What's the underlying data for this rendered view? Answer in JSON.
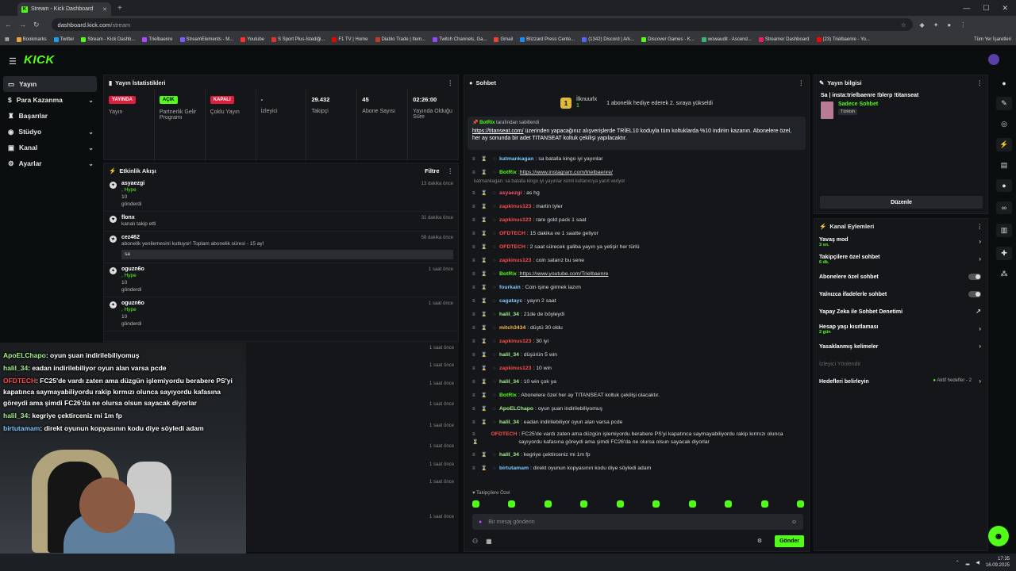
{
  "browser": {
    "tab_title": "Stream - Kick Dashboard",
    "url_host": "dashboard.kick.com",
    "url_path": "/stream",
    "bookmarks": [
      "Bookmarks",
      "Twitter",
      "Stream - Kick Dashb...",
      "Trielbaenre",
      "StreamElements - M...",
      "Youtube",
      "S Sport Plus-İstediği...",
      "F1 TV | Home",
      "Diablo Trade | Item...",
      "Twitch Channels, Ga...",
      "Gmail",
      "Blizzard Press Cente...",
      "(1342) Discord | Ark...",
      "Discover Games - K...",
      "wowaudit - Ascend...",
      "Streamer Dashboard",
      "(23) Trielbaenre - Yo..."
    ],
    "bookmarks_all": "Tüm Yer İşaretleri"
  },
  "brand": {
    "logo": "KICK",
    "accent": "#53fc18"
  },
  "sidebar": {
    "items": [
      {
        "label": "Yayın"
      },
      {
        "label": "Para Kazanma"
      },
      {
        "label": "Başarılar"
      },
      {
        "label": "Stüdyo"
      },
      {
        "label": "Kanal"
      },
      {
        "label": "Ayarlar"
      }
    ]
  },
  "stats": {
    "title": "Yayın İstatistikleri",
    "items": [
      {
        "value": "YAYINDA",
        "label": "Yayın"
      },
      {
        "value": "AÇIK",
        "label": "Partnerlik Gelir Programı"
      },
      {
        "value": "KAPALI",
        "label": "Çoklu Yayın"
      },
      {
        "value": "-",
        "label": "İzleyici"
      },
      {
        "value": "29.432",
        "label": "Takipçi"
      },
      {
        "value": "45",
        "label": "Abone Sayısı"
      },
      {
        "value": "02:26:00",
        "label": "Yayında Olduğu Süre"
      }
    ]
  },
  "feed": {
    "title": "Etkinlik Akışı",
    "filter": "Filtre",
    "events": [
      {
        "user": "asyaezgi",
        "line1": ", Hype",
        "line2": "10",
        "line3": "gönderdi",
        "time": "13 dakika önce"
      },
      {
        "user": "flonx",
        "line1": "kanalı takip etti",
        "time": "31 dakika önce"
      },
      {
        "user": "cez462",
        "line1": "abonelik yenilemesini kutluyor! Toplam abonelik süresi - 15 ay!",
        "note": "sa",
        "time": "58 dakika önce"
      },
      {
        "user": "oguzn6o",
        "line1": ", Hype",
        "line2": "10",
        "line3": "gönderdi",
        "time": "1 saat önce"
      },
      {
        "user": "oguzn6o",
        "line1": ", Hype",
        "line2": "10",
        "line3": "gönderdi",
        "time": "1 saat önce"
      }
    ],
    "lower_times": [
      "1 saat önce",
      "1 saat önce",
      "1 saat önce",
      "1 saat önce",
      "1 saat önce",
      "1 saat önce",
      "1 saat önce",
      "1 saat önce",
      "1 saat önce"
    ],
    "hidden_frag": "kanalı takip etti"
  },
  "cam_chat": [
    {
      "user": "ApoELChapo",
      "text": ": oyun şuan indirilebiliyomuş"
    },
    {
      "user": "halil_34",
      "text": ": eadan indirilebiliyor oyun alan varsa pcde"
    },
    {
      "user": "OFDTECH",
      "text": ": FC25'de vardı zaten ama düzgün işlemiyordu berabere PS'yi kapatınca saymayabiliyordu rakip kırmızı olunca sayıyordu kafasına göreydi ama şimdi FC26'da ne olursa olsun sayacak diyorlar"
    },
    {
      "user": "halil_34",
      "text": ": kegriye çektirceniz mi 1m fp"
    },
    {
      "user": "birtutamam",
      "text": ": direkt oyunun kopyasının kodu diye söyledi adam"
    }
  ],
  "chat": {
    "title": "Sohbet",
    "gift_user": "İlknuurlx",
    "gift_count": "1",
    "gift_text": "1 abonelik hediye ederek 2. sıraya yükseldi",
    "pinned_by_user": "BotRix",
    "pinned_by_suffix": "tarafından sabitlendi",
    "pinned_link": "https://titanseat.com/",
    "pinned_text": "üzerinden yapacağınız alışverişlerde TRİEL10 koduyla tüm koltuklarda %10 indirim kazanın. Abonelere özel, her ay sonunda bir adet TITANSEAT koltuk çekilişi yapılacaktır.",
    "messages": [
      {
        "user": "katmankagan",
        "text": ": sa batalla kingo iyi yayınlar",
        "color": "#7fc8ff"
      },
      {
        "user": "BotRix",
        "text": ": ",
        "link": "https://www.instagram.com/trielbaenre/",
        "color": "#53fc18"
      },
      {
        "reply": "katmankagan: sa batalla kingo iyi yayınlar isimli kullanıcıya yanıt veriyor"
      },
      {
        "user": "asyaezgi",
        "text": ": as hg",
        "color": "#ff4d6d"
      },
      {
        "user": "zapkinus123",
        "text": ": martin tyler",
        "color": "#ff4d4d"
      },
      {
        "user": "zapkinus123",
        "text": ": rare gold pack 1 saat",
        "color": "#ff4d4d"
      },
      {
        "user": "OFDTECH",
        "text": ": 15 dakika ve 1 saatte geliyor",
        "color": "#ff4d4d"
      },
      {
        "user": "OFDTECH",
        "text": ": 2 saat sürecek galiba yayın ya yetişir her türlü",
        "color": "#ff4d4d"
      },
      {
        "user": "zapkinus123",
        "text": ": coin satarız bu sene",
        "color": "#ff4d4d"
      },
      {
        "user": "BotRix",
        "text": ": ",
        "link": "https://www.youtube.com/Trielbaenre",
        "color": "#53fc18"
      },
      {
        "user": "fourkain",
        "text": ": Coin işine girmek lazım",
        "color": "#7fc8ff"
      },
      {
        "user": "cagatayc",
        "text": ": yayın 2 saat",
        "color": "#7fc8ff"
      },
      {
        "user": "halil_34",
        "text": ": 21de de böyleydi",
        "color": "#a4ee8a"
      },
      {
        "user": "mitch3434",
        "text": ": düştü 30 oldu",
        "color": "#ffb84d"
      },
      {
        "user": "zapkinus123",
        "text": ": 30 iyi",
        "color": "#ff4d4d"
      },
      {
        "user": "halil_34",
        "text": ": düşürün 5 win",
        "color": "#a4ee8a"
      },
      {
        "user": "zapkinus123",
        "text": ": 10 win",
        "color": "#ff4d4d"
      },
      {
        "user": "halil_34",
        "text": ": 10 win çok ya",
        "color": "#a4ee8a"
      },
      {
        "user": "BotRix",
        "text": ": Abonelere özel her ay TITANSEAT koltuk çekilişi olacaktır.",
        "color": "#53fc18"
      },
      {
        "user": "ApoELChapo",
        "text": ": oyun şuan indirilebiliyomuş",
        "color": "#a4ee8a"
      },
      {
        "user": "halil_34",
        "text": ": eadan indirilebiliyor oyun alan varsa pcde",
        "color": "#a4ee8a"
      },
      {
        "user": "OFDTECH",
        "text": ": FC25'de vardı zaten ama düzgün işlemiyordu berabere PS'yi kapatınca saymayabiliyordu rakip kırmızı olunca sayıyordu kafasına göreydi ama şimdi FC26'da ne olursa olsun sayacak diyorlar",
        "color": "#ff4d4d",
        "tall": true
      },
      {
        "user": "halil_34",
        "text": ": kegriye çektirceniz mi 1m fp",
        "color": "#a4ee8a"
      },
      {
        "user": "birtutamam",
        "text": ": direkt oyunun kopyasının kodu diye söyledi adam",
        "color": "#7fc8ff"
      }
    ],
    "followers_only": "Takipçilere Özel",
    "input_placeholder": "Bir mesaj gönderin",
    "send": "Gönder"
  },
  "info": {
    "title": "Yayın bilgisi",
    "stream_title": "Sa | insta:trielbaenre !blerp !titanseat",
    "category": "Sadece Sohbet",
    "language": "Türkish",
    "edit": "Düzenle"
  },
  "actions": {
    "title": "Kanal Eylemleri",
    "items": [
      {
        "label": "Yavaş mod",
        "sub": "3 sn.",
        "kind": "arrow"
      },
      {
        "label": "Takipçilere özel sohbet",
        "sub": "6 dk.",
        "kind": "arrow"
      },
      {
        "label": "Abonelere özel sohbet",
        "kind": "toggle"
      },
      {
        "label": "Yalnızca ifadelerle sohbet",
        "kind": "toggle"
      },
      {
        "label": "Yapay Zeka ile Sohbet Denetimi",
        "kind": "external"
      },
      {
        "label": "Hesap yaşı kısıtlaması",
        "sub": "2 gün",
        "kind": "arrow"
      },
      {
        "label": "Yasaklanmış kelimeler",
        "kind": "arrow"
      },
      {
        "label": "İzleyici Yönlendir",
        "kind": "dim"
      },
      {
        "label": "Hedefleri belirleyin",
        "extra": "Aktif hedefler - 2",
        "kind": "arrow"
      }
    ]
  },
  "taskbar": {
    "time": "17:35",
    "date": "16.09.2025"
  }
}
